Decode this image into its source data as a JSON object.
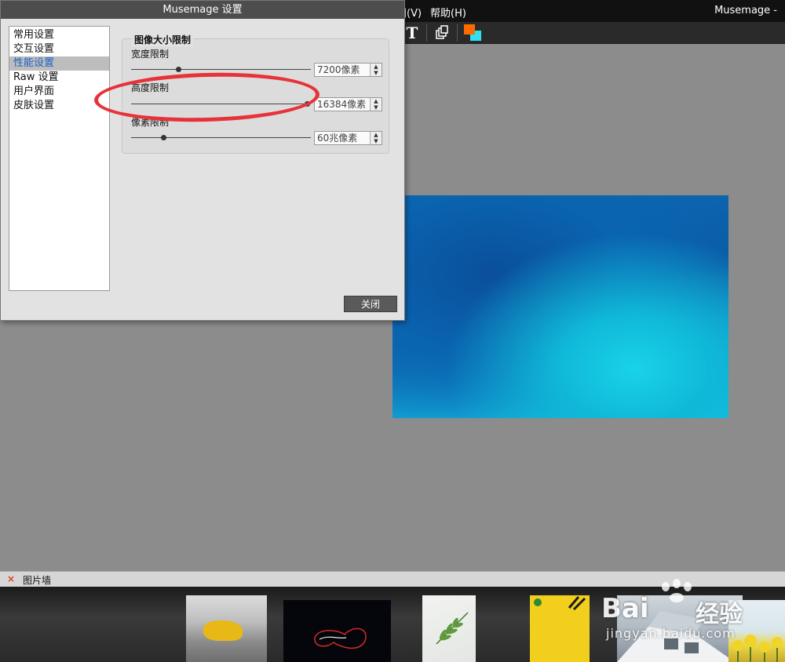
{
  "menubar": {
    "view_label": "图(V)",
    "help_label": "帮助(H)",
    "app_title": "Musemage -"
  },
  "toolbar": {
    "text_tool_glyph": "T",
    "icons": [
      "text-tool-icon",
      "layers-copy-icon",
      "color-swatch-icon"
    ],
    "colors": {
      "foreground": "#ff6a00",
      "background": "#31e0f2"
    }
  },
  "dialog": {
    "title": "Musemage 设置",
    "nav_items": [
      "常用设置",
      "交互设置",
      "性能设置",
      "Raw 设置",
      "用户界面",
      "皮肤设置"
    ],
    "selected_nav": "性能设置",
    "group_title": "图像大小限制",
    "fields": [
      {
        "label": "宽度限制",
        "value": "7200像素",
        "slider_fraction": 0.26
      },
      {
        "label": "高度限制",
        "value": "16384像素",
        "slider_fraction": 0.98
      },
      {
        "label": "像素限制",
        "value": "60兆像素",
        "slider_fraction": 0.18
      }
    ],
    "close_label": "关闭"
  },
  "image_wall": {
    "close_glyph": "×",
    "title": "图片墙"
  },
  "watermark": {
    "brand": "Bai",
    "brand_suffix": "经验",
    "url": "jingyan.baidu.com"
  },
  "colors": {
    "annotation_ring": "#e8323a",
    "nav_selected_text": "#1c62c8"
  }
}
